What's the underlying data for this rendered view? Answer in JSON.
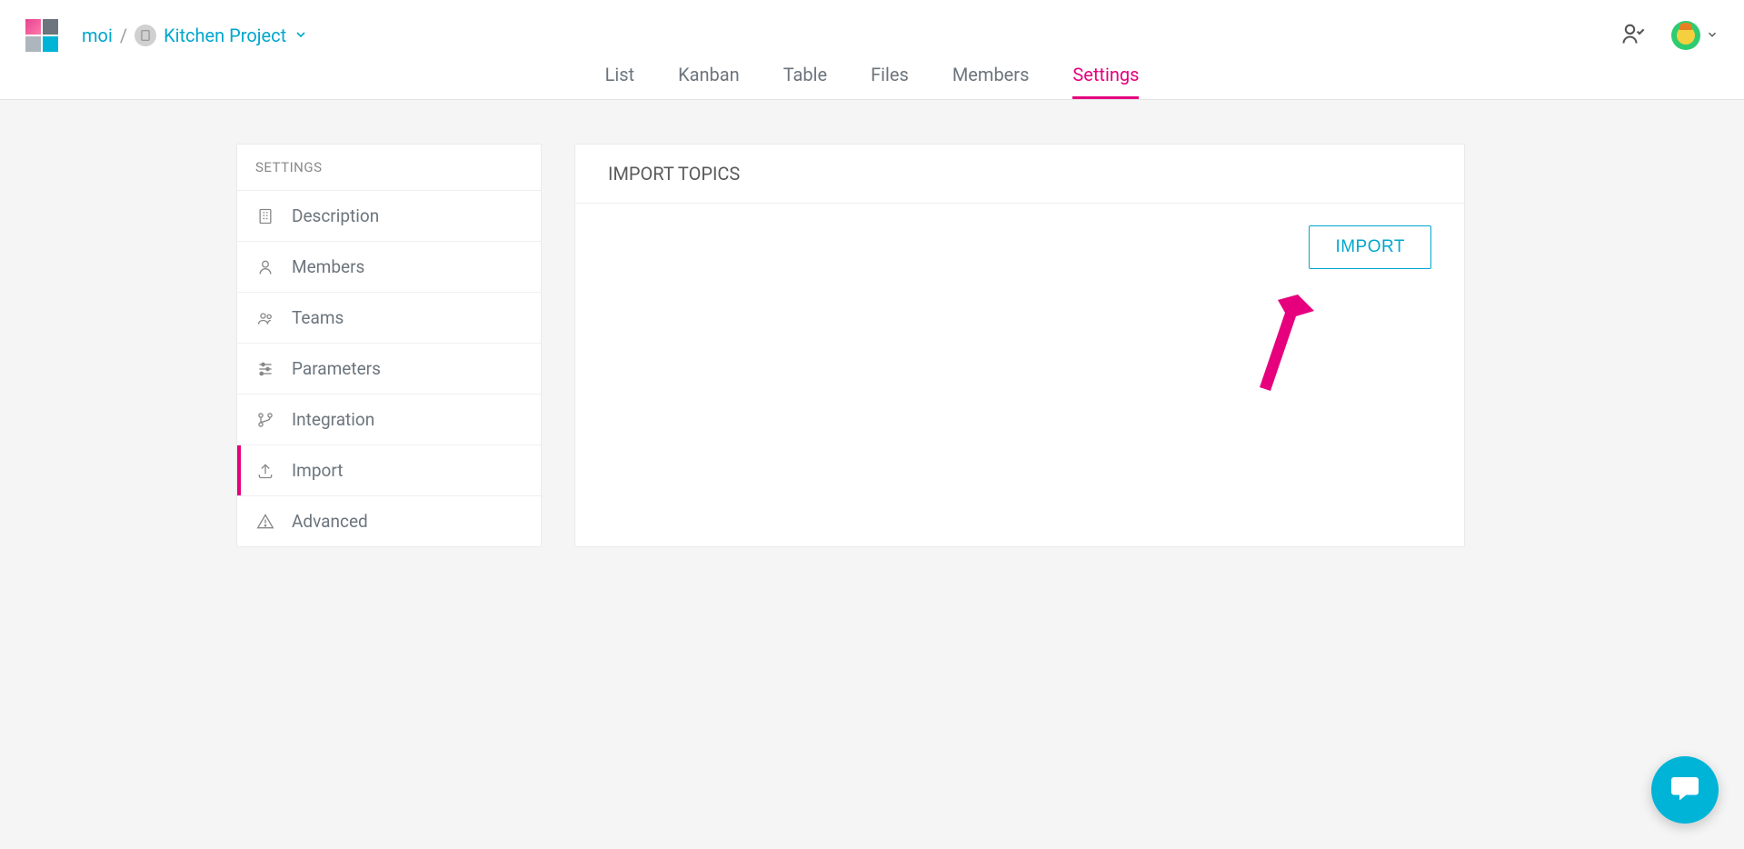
{
  "breadcrumb": {
    "org": "moi",
    "separator": "/",
    "project": "Kitchen Project"
  },
  "tabs": [
    {
      "label": "List",
      "active": false
    },
    {
      "label": "Kanban",
      "active": false
    },
    {
      "label": "Table",
      "active": false
    },
    {
      "label": "Files",
      "active": false
    },
    {
      "label": "Members",
      "active": false
    },
    {
      "label": "Settings",
      "active": true
    }
  ],
  "sidebar": {
    "header": "SETTINGS",
    "items": [
      {
        "label": "Description",
        "icon": "building-icon",
        "active": false
      },
      {
        "label": "Members",
        "icon": "user-icon",
        "active": false
      },
      {
        "label": "Teams",
        "icon": "users-icon",
        "active": false
      },
      {
        "label": "Parameters",
        "icon": "sliders-icon",
        "active": false
      },
      {
        "label": "Integration",
        "icon": "branch-icon",
        "active": false
      },
      {
        "label": "Import",
        "icon": "upload-icon",
        "active": true
      },
      {
        "label": "Advanced",
        "icon": "warning-icon",
        "active": false
      }
    ]
  },
  "main": {
    "header": "IMPORT TOPICS",
    "import_button": "IMPORT"
  },
  "icons": {
    "building-icon": "building",
    "user-icon": "user",
    "users-icon": "users",
    "sliders-icon": "sliders",
    "branch-icon": "branch",
    "upload-icon": "upload",
    "warning-icon": "warning"
  }
}
